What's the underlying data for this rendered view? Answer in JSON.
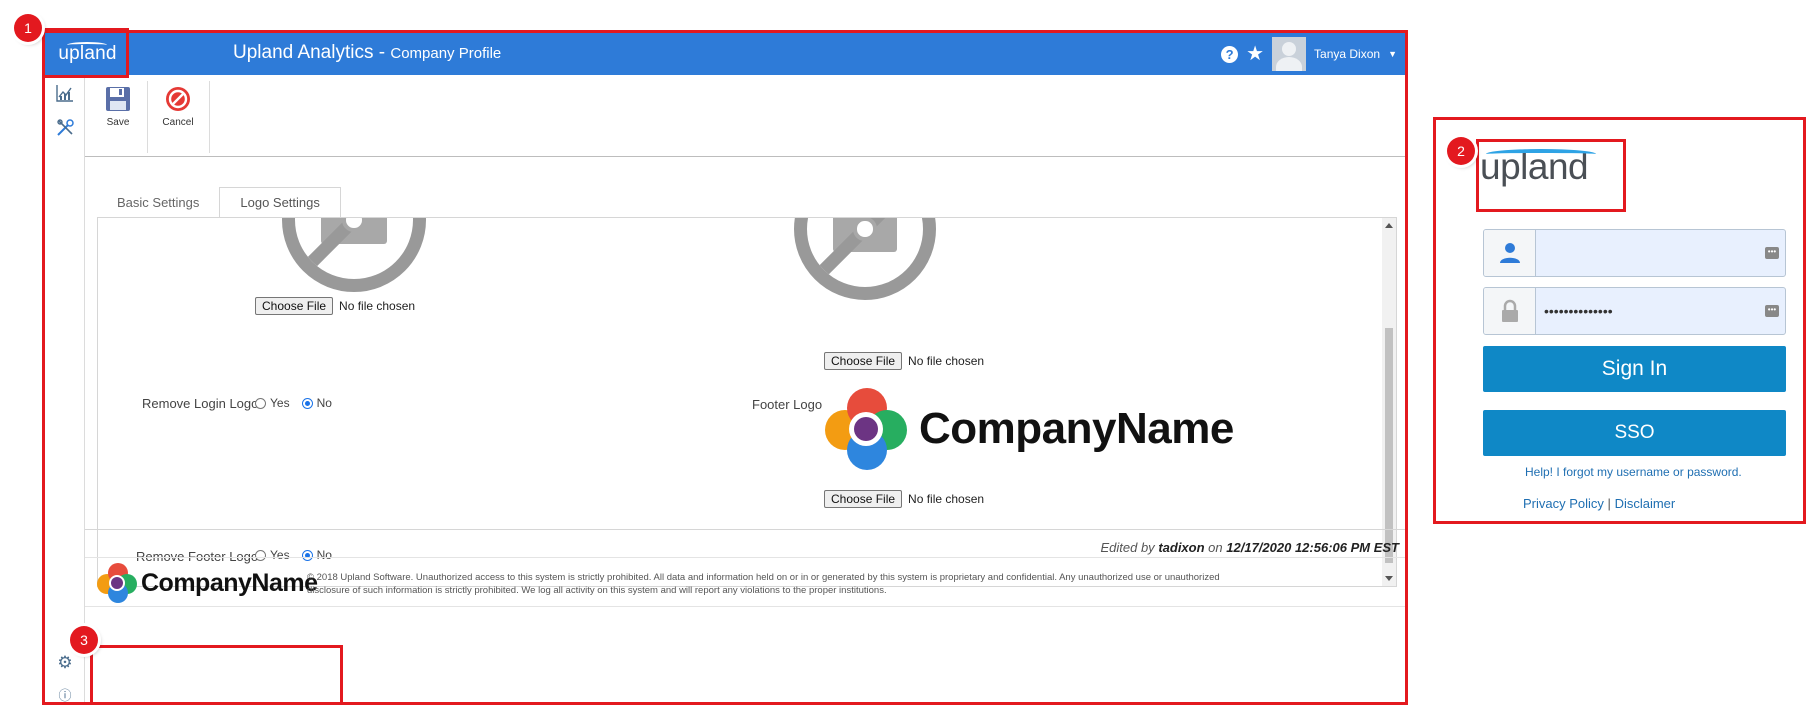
{
  "callouts": [
    "1",
    "2",
    "3"
  ],
  "app": {
    "logo_text": "upland",
    "title": "Upland Analytics - ",
    "subtitle": "Company Profile",
    "help_glyph": "?",
    "user_name": "Tanya Dixon"
  },
  "rail": {
    "icons": [
      "analytics-chart-icon",
      "tools-icon",
      "gear-icon",
      "info-icon"
    ]
  },
  "toolbar": {
    "save_label": "Save",
    "cancel_label": "Cancel"
  },
  "tabs": [
    "Basic Settings",
    "Logo Settings"
  ],
  "settings": {
    "choose_file_label": "Choose File",
    "no_file_text": "No file chosen",
    "remove_login_logo_label": "Remove Login Logo",
    "remove_footer_logo_label": "Remove Footer Logo",
    "footer_logo_label": "Footer Logo",
    "yes_label": "Yes",
    "no_label": "No",
    "remove_login_logo_value": "No",
    "remove_footer_logo_value": "No",
    "company_logo_text": "CompanyName"
  },
  "edited": {
    "prefix": "Edited by",
    "user": "tadixon",
    "middle": "on",
    "timestamp": "12/17/2020 12:56:06 PM EST"
  },
  "footer": {
    "company_logo_text": "CompanyName",
    "disclaimer": "© 2018 Upland Software. Unauthorized access to this system is strictly prohibited. All data and information held on or in or generated by this system is proprietary and confidential. Any unauthorized use or unauthorized disclosure of such information is strictly prohibited. We log all activity on this system and will report any violations to the proper institutions."
  },
  "login": {
    "logo_text": "upland",
    "username_value": "",
    "password_value": "••••••••••••••",
    "sign_in_label": "Sign In",
    "sso_label": "SSO",
    "help_text": "Help!  I forgot my username or password.",
    "privacy_label": "Privacy Policy",
    "separator": "|",
    "disclaimer_label": "Disclaimer"
  },
  "colors": {
    "header_blue": "#2e7bd8",
    "callout_red": "#e3191f",
    "button_blue": "#0f88c6",
    "link_blue": "#1f6fb2"
  }
}
